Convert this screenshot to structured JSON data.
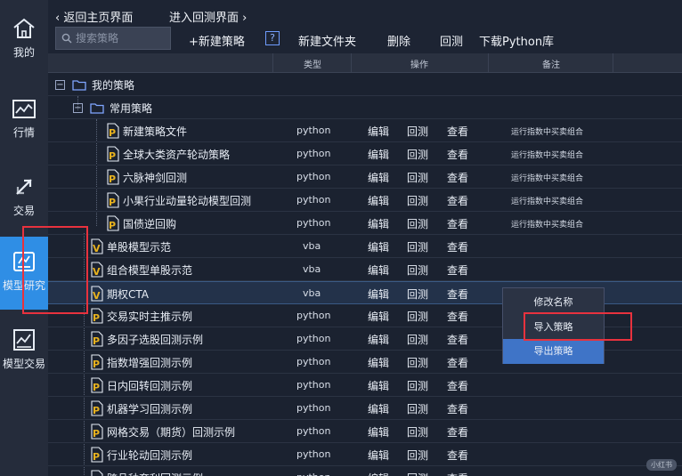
{
  "topbar": {
    "back_home": "返回主页界面",
    "enter_backtest": "进入回测界面",
    "search_placeholder": "搜索策略",
    "new_strategy": "+新建策略",
    "help": "?",
    "new_folder": "新建文件夹",
    "delete": "删除",
    "backtest": "回测",
    "download_python": "下载Python库"
  },
  "sidebar": {
    "items": [
      {
        "label": "我的",
        "icon": "home-icon"
      },
      {
        "label": "行情",
        "icon": "market-chart-icon"
      },
      {
        "label": "交易",
        "icon": "trade-arrows-icon"
      },
      {
        "label": "模型研究",
        "icon": "model-research-icon"
      },
      {
        "label": "模型交易",
        "icon": "model-trade-icon"
      }
    ]
  },
  "table": {
    "headers": {
      "type": "类型",
      "ops": "操作",
      "note": "备注"
    },
    "op_edit": "编辑",
    "op_backtest": "回测",
    "op_view": "查看",
    "folder_root": "我的策略",
    "folder_sub": "常用策略",
    "rows": [
      {
        "name": "新建策略文件",
        "type": "python",
        "note": "运行指数中买卖组合"
      },
      {
        "name": "全球大类资产轮动策略",
        "type": "python",
        "note": "运行指数中买卖组合"
      },
      {
        "name": "六脉神剑回测",
        "type": "python",
        "note": "运行指数中买卖组合"
      },
      {
        "name": "小果行业动量轮动模型回测",
        "type": "python",
        "note": "运行指数中买卖组合"
      },
      {
        "name": "国债逆回购",
        "type": "python",
        "note": "运行指数中买卖组合"
      },
      {
        "name": "单股模型示范",
        "type": "vba",
        "note": ""
      },
      {
        "name": "组合模型单股示范",
        "type": "vba",
        "note": ""
      },
      {
        "name": "期权CTA",
        "type": "vba",
        "note": ""
      },
      {
        "name": "交易实时主推示例",
        "type": "python",
        "note": ""
      },
      {
        "name": "多因子选股回测示例",
        "type": "python",
        "note": ""
      },
      {
        "name": "指数增强回测示例",
        "type": "python",
        "note": ""
      },
      {
        "name": "日内回转回测示例",
        "type": "python",
        "note": ""
      },
      {
        "name": "机器学习回测示例",
        "type": "python",
        "note": ""
      },
      {
        "name": "网格交易（期货）回测示例",
        "type": "python",
        "note": ""
      },
      {
        "name": "行业轮动回测示例",
        "type": "python",
        "note": ""
      },
      {
        "name": "跨品种套利回测示例",
        "type": "python",
        "note": ""
      }
    ]
  },
  "context_menu": {
    "rename": "修改名称",
    "import": "导入策略",
    "export": "导出策略"
  },
  "watermark": "小红书",
  "colors": {
    "accent": "#2f8ee5",
    "highlight_box": "#e8323e",
    "python_icon": "#e8b21f"
  }
}
